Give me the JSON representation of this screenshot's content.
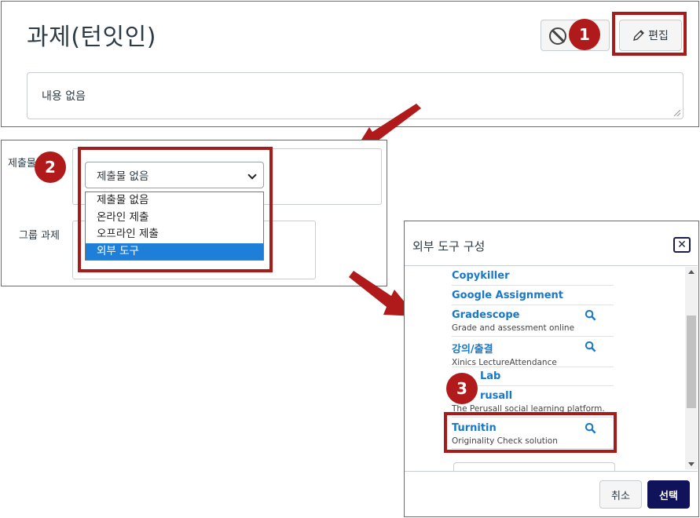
{
  "accent_color": "#b01a1a",
  "assignment": {
    "title": "과제(턴잇인)",
    "edit_label": "편집",
    "description": "내용 없음"
  },
  "submission": {
    "label": "제출물",
    "group_label": "그룹 과제",
    "selected_value": "제출물 없음",
    "options": [
      "제출물 없음",
      "온라인 제출",
      "오프라인 제출",
      "외부 도구"
    ],
    "highlighted_option": "외부 도구"
  },
  "dialog": {
    "title": "외부 도구 구성",
    "tools": [
      {
        "name": "Copykiller",
        "description": "",
        "icon": "magnifier-icon",
        "has_icon": false
      },
      {
        "name": "Google Assignment",
        "description": "",
        "has_icon": false
      },
      {
        "name": "Gradescope",
        "description": "Grade and assessment online",
        "has_icon": true
      },
      {
        "name": "강의/출결",
        "description": "Xinics LectureAttendance",
        "has_icon": true
      },
      {
        "name": "Lab",
        "description": "",
        "has_icon": false
      },
      {
        "name": "rusall",
        "description": "The Perusall social learning platform.",
        "has_icon": false
      },
      {
        "name": "Turnitin",
        "description": "Originality Check solution",
        "has_icon": true
      }
    ],
    "cancel_label": "취소",
    "select_label": "선택"
  },
  "steps": [
    "1",
    "2",
    "3"
  ]
}
